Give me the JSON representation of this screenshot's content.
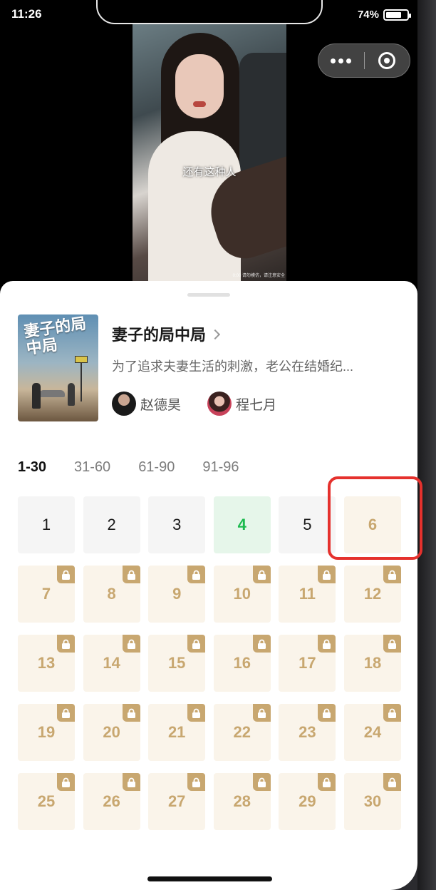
{
  "status_bar": {
    "time": "11:26",
    "battery_percent": "74%",
    "battery_level": 0.74
  },
  "video": {
    "subtitle": "还有这种人",
    "caption": "0:00 请勿模仿，请注意安全"
  },
  "capsule": {
    "more_icon": "ellipsis-icon",
    "close_icon": "target-icon"
  },
  "drama": {
    "title": "妻子的局中局",
    "cover_title": "妻子的局中局",
    "description": "为了追求夫妻生活的刺激，老公在结婚纪...",
    "actors": [
      {
        "name": "赵德昊"
      },
      {
        "name": "程七月"
      }
    ]
  },
  "episode_tabs": [
    {
      "label": "1-30",
      "active": true
    },
    {
      "label": "31-60",
      "active": false
    },
    {
      "label": "61-90",
      "active": false
    },
    {
      "label": "91-96",
      "active": false
    }
  ],
  "episodes": [
    {
      "number": "1",
      "state": "free"
    },
    {
      "number": "2",
      "state": "free"
    },
    {
      "number": "3",
      "state": "free"
    },
    {
      "number": "4",
      "state": "current"
    },
    {
      "number": "5",
      "state": "free"
    },
    {
      "number": "6",
      "state": "locked-nolock"
    },
    {
      "number": "7",
      "state": "locked"
    },
    {
      "number": "8",
      "state": "locked"
    },
    {
      "number": "9",
      "state": "locked"
    },
    {
      "number": "10",
      "state": "locked"
    },
    {
      "number": "11",
      "state": "locked"
    },
    {
      "number": "12",
      "state": "locked"
    },
    {
      "number": "13",
      "state": "locked"
    },
    {
      "number": "14",
      "state": "locked"
    },
    {
      "number": "15",
      "state": "locked"
    },
    {
      "number": "16",
      "state": "locked"
    },
    {
      "number": "17",
      "state": "locked"
    },
    {
      "number": "18",
      "state": "locked"
    },
    {
      "number": "19",
      "state": "locked"
    },
    {
      "number": "20",
      "state": "locked"
    },
    {
      "number": "21",
      "state": "locked"
    },
    {
      "number": "22",
      "state": "locked"
    },
    {
      "number": "23",
      "state": "locked"
    },
    {
      "number": "24",
      "state": "locked"
    },
    {
      "number": "25",
      "state": "locked"
    },
    {
      "number": "26",
      "state": "locked"
    },
    {
      "number": "27",
      "state": "locked"
    },
    {
      "number": "28",
      "state": "locked"
    },
    {
      "number": "29",
      "state": "locked"
    },
    {
      "number": "30",
      "state": "locked"
    }
  ],
  "colors": {
    "accent_gold": "#c8a770",
    "current_green": "#1dba4f",
    "highlight_red": "#e5312d"
  }
}
